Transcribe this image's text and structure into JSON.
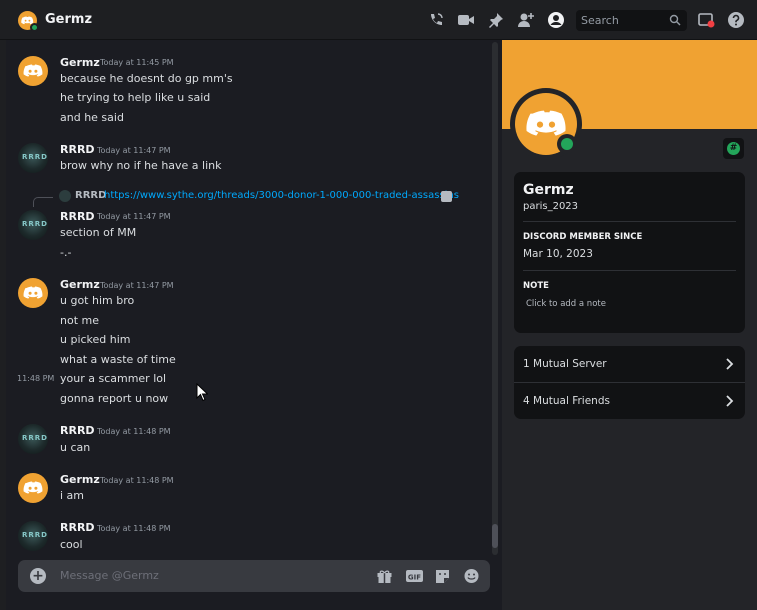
{
  "header": {
    "title": "Germz",
    "search_placeholder": "Search",
    "icons": [
      "call-icon",
      "video-icon",
      "pin-icon",
      "add-friend-icon",
      "user-profile-icon",
      "search-icon",
      "inbox-icon",
      "help-icon"
    ]
  },
  "messages": [
    {
      "author": "Germz",
      "timestamp": "Today at 11:45 PM",
      "lines": [
        "because he doesnt do gp mm's",
        "he trying to help like u said",
        "and he said"
      ]
    },
    {
      "author": "RRRD",
      "timestamp": "Today at 11:47 PM",
      "lines": [
        "brow why no if he have a link"
      ]
    },
    {
      "reply_author": "RRRD",
      "reply_link": "https://www.sythe.org/threads/3000-donor-1-000-000-traded-assassins",
      "author": "RRRD",
      "timestamp": "Today at 11:47 PM",
      "lines": [
        "section of MM",
        "-.-"
      ]
    },
    {
      "author": "Germz",
      "timestamp": "Today at 11:47 PM",
      "lines": [
        "u got him bro",
        "not me",
        "u picked him",
        "what a  waste of time",
        "your a scammer lol",
        "gonna report u now"
      ],
      "hover_time": "11:48 PM"
    },
    {
      "author": "RRRD",
      "timestamp": "Today at 11:48 PM",
      "lines": [
        "u can"
      ]
    },
    {
      "author": "Germz",
      "timestamp": "Today at 11:48 PM",
      "lines": [
        "i am"
      ]
    },
    {
      "author": "RRRD",
      "timestamp": "Today at 11:48 PM",
      "lines": [
        "cool"
      ]
    }
  ],
  "composer": {
    "placeholder": "Message @Germz"
  },
  "profile": {
    "display_name": "Germz",
    "username": "paris_2023",
    "member_since_label": "DISCORD MEMBER SINCE",
    "member_since": "Mar 10, 2023",
    "note_label": "NOTE",
    "note_placeholder": "Click to add a note",
    "mutual_servers": "1 Mutual Server",
    "mutual_friends": "4 Mutual Friends"
  },
  "avatar_text": "RRRD",
  "colors": {
    "brand_orange": "#f0a232",
    "online_green": "#23a55a",
    "link_blue": "#00a8fc"
  }
}
